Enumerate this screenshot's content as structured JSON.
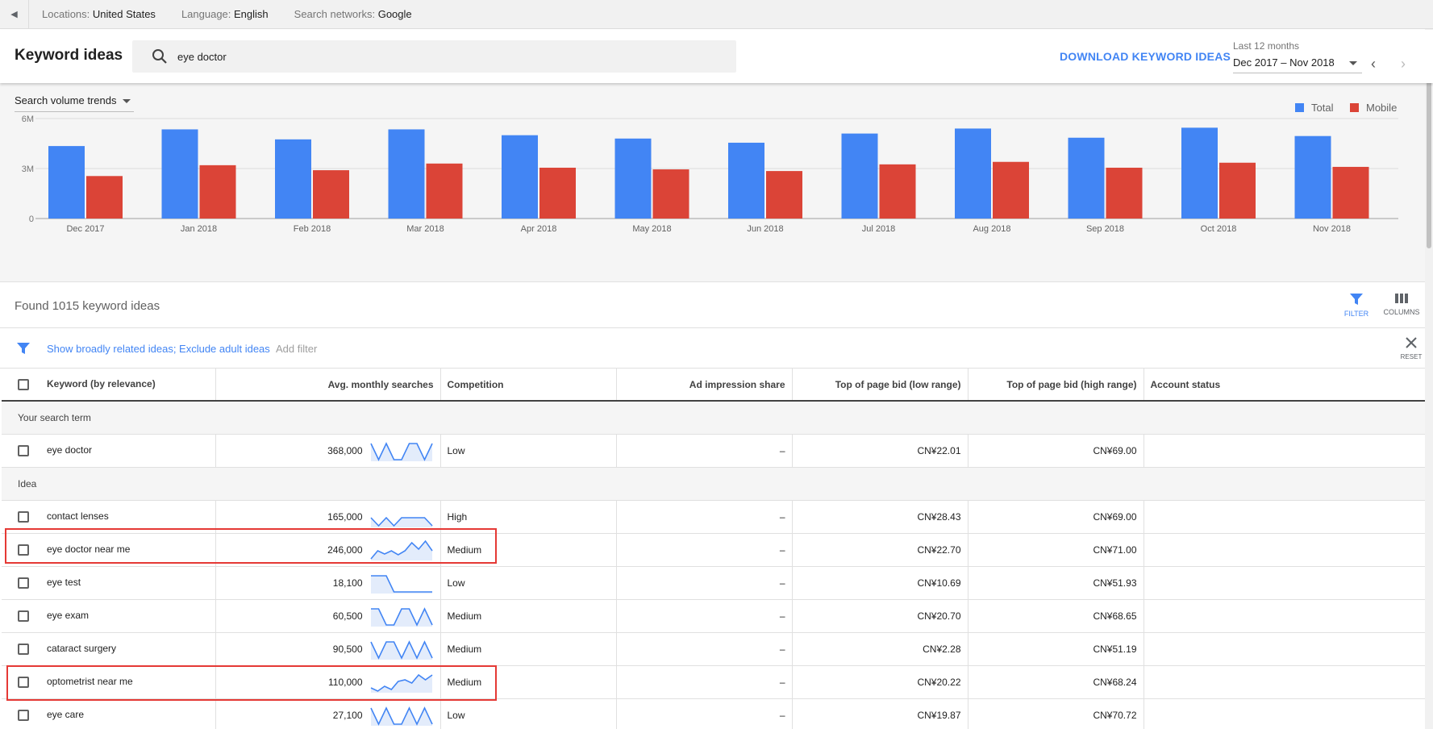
{
  "topbar": {
    "locations_label": "Locations:",
    "locations_value": "United States",
    "language_label": "Language:",
    "language_value": "English",
    "networks_label": "Search networks:",
    "networks_value": "Google"
  },
  "header": {
    "title": "Keyword ideas",
    "search_value": "eye doctor",
    "download_label": "DOWNLOAD KEYWORD IDEAS",
    "range_label": "Last 12 months",
    "range_value": "Dec 2017 – Nov 2018"
  },
  "chart_controls": {
    "trend_select": "Search volume trends"
  },
  "chart_data": {
    "type": "bar",
    "categories": [
      "Dec 2017",
      "Jan 2018",
      "Feb 2018",
      "Mar 2018",
      "Apr 2018",
      "May 2018",
      "Jun 2018",
      "Jul 2018",
      "Aug 2018",
      "Sep 2018",
      "Oct 2018",
      "Nov 2018"
    ],
    "series": [
      {
        "name": "Total",
        "color": "#4285f4",
        "values": [
          4.35,
          5.35,
          4.75,
          5.35,
          5.0,
          4.8,
          4.55,
          5.1,
          5.4,
          4.85,
          5.45,
          4.95
        ]
      },
      {
        "name": "Mobile",
        "color": "#db4437",
        "values": [
          2.55,
          3.2,
          2.9,
          3.3,
          3.05,
          2.95,
          2.85,
          3.25,
          3.4,
          3.05,
          3.35,
          3.1
        ]
      }
    ],
    "yticks": [
      "0",
      "3M",
      "6M"
    ],
    "ylim": [
      0,
      6
    ],
    "unit": "millions",
    "grid": true,
    "legend": "top-right"
  },
  "results": {
    "found_text": "Found 1015 keyword ideas",
    "filter_label": "FILTER",
    "columns_label": "COLUMNS"
  },
  "filters": {
    "active": "Show broadly related ideas; Exclude adult ideas",
    "add": "Add filter",
    "reset": "RESET"
  },
  "table": {
    "headers": {
      "keyword": "Keyword (by relevance)",
      "searches": "Avg. monthly searches",
      "competition": "Competition",
      "impression": "Ad impression share",
      "bid_low": "Top of page bid (low range)",
      "bid_high": "Top of page bid (high range)",
      "status": "Account status"
    },
    "section_search_term": "Your search term",
    "section_idea": "Idea",
    "search_term_row": {
      "keyword": "eye doctor",
      "searches": "368,000",
      "competition": "Low",
      "impression": "–",
      "bid_low": "CN¥22.01",
      "bid_high": "CN¥69.00",
      "spark": [
        3,
        1,
        3,
        1,
        1,
        3,
        3,
        1,
        3
      ]
    },
    "idea_rows": [
      {
        "keyword": "contact lenses",
        "searches": "165,000",
        "competition": "High",
        "impression": "–",
        "bid_low": "CN¥28.43",
        "bid_high": "CN¥69.00",
        "spark": [
          2,
          1,
          2,
          1,
          2,
          2,
          2,
          2,
          1
        ]
      },
      {
        "keyword": "eye doctor near me",
        "searches": "246,000",
        "competition": "Medium",
        "impression": "–",
        "bid_low": "CN¥22.70",
        "bid_high": "CN¥71.00",
        "spark": [
          1,
          2,
          1.6,
          2,
          1.5,
          2,
          3,
          2.2,
          3.2,
          2
        ]
      },
      {
        "keyword": "eye test",
        "searches": "18,100",
        "competition": "Low",
        "impression": "–",
        "bid_low": "CN¥10.69",
        "bid_high": "CN¥51.93",
        "spark": [
          3,
          3,
          3,
          1,
          1,
          1,
          1,
          1,
          1
        ]
      },
      {
        "keyword": "eye exam",
        "searches": "60,500",
        "competition": "Medium",
        "impression": "–",
        "bid_low": "CN¥20.70",
        "bid_high": "CN¥68.65",
        "spark": [
          3,
          3,
          1,
          1,
          3,
          3,
          1,
          3,
          1
        ]
      },
      {
        "keyword": "cataract surgery",
        "searches": "90,500",
        "competition": "Medium",
        "impression": "–",
        "bid_low": "CN¥2.28",
        "bid_high": "CN¥51.19",
        "spark": [
          3,
          1,
          3,
          3,
          1,
          3,
          1,
          3,
          1
        ]
      },
      {
        "keyword": "optometrist near me",
        "searches": "110,000",
        "competition": "Medium",
        "impression": "–",
        "bid_low": "CN¥20.22",
        "bid_high": "CN¥68.24",
        "spark": [
          1.4,
          1,
          1.6,
          1.2,
          2.2,
          2.4,
          2,
          3,
          2.4,
          3
        ]
      },
      {
        "keyword": "eye care",
        "searches": "27,100",
        "competition": "Low",
        "impression": "–",
        "bid_low": "CN¥19.87",
        "bid_high": "CN¥70.72",
        "spark": [
          3,
          1,
          3,
          1,
          1,
          3,
          1,
          3,
          1
        ]
      }
    ],
    "highlighted_rows": [
      1,
      5
    ]
  }
}
